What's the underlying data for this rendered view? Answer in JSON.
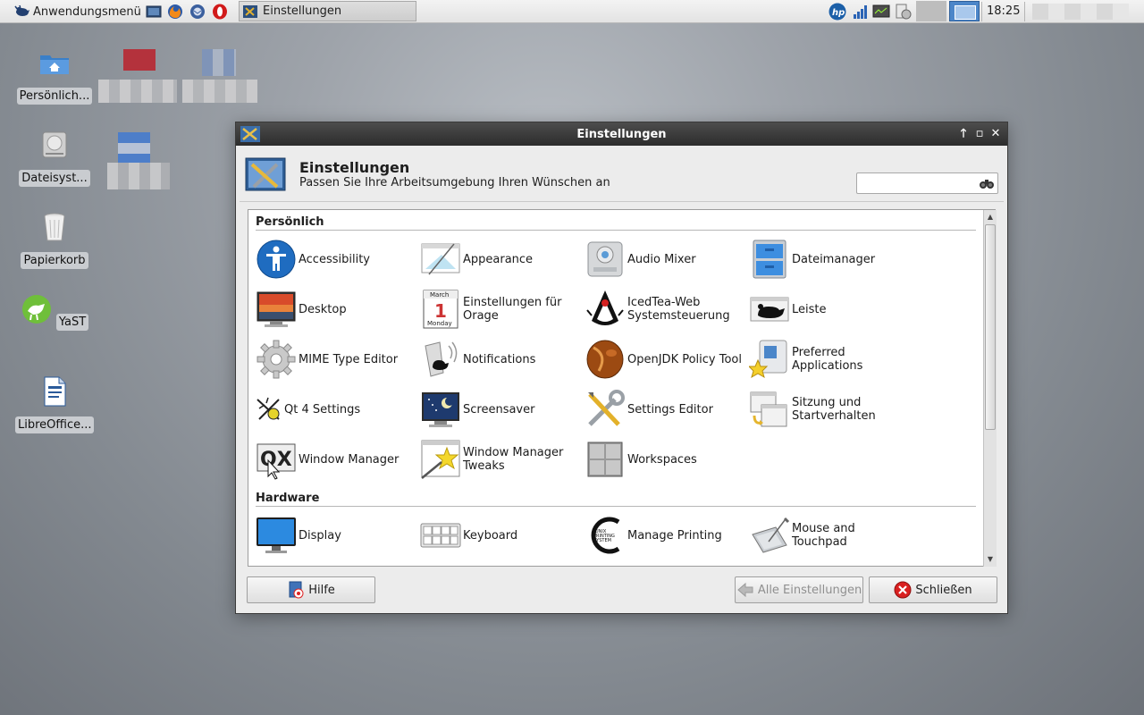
{
  "panel": {
    "menu_label": "Anwendungsmenü",
    "task_label": "Einstellungen",
    "clock": "18:25"
  },
  "desktop": {
    "icons": [
      {
        "label": "Persönlich..."
      },
      {
        "label": "Dateisyst..."
      },
      {
        "label": "Papierkorb"
      },
      {
        "label": "YaST"
      },
      {
        "label": "LibreOffice..."
      }
    ]
  },
  "window": {
    "title": "Einstellungen",
    "header_title": "Einstellungen",
    "header_subtitle": "Passen Sie Ihre Arbeitsumgebung Ihren Wünschen an",
    "search_value": "",
    "sections": [
      {
        "title": "Persönlich",
        "items": [
          {
            "label": "Accessibility",
            "icon": "accessibility-icon"
          },
          {
            "label": "Appearance",
            "icon": "appearance-icon"
          },
          {
            "label": "Audio Mixer",
            "icon": "audio-mixer-icon"
          },
          {
            "label": "Dateimanager",
            "icon": "file-manager-icon"
          },
          {
            "label": "Desktop",
            "icon": "desktop-icon"
          },
          {
            "label": "Einstellungen für Orage",
            "icon": "calendar-icon"
          },
          {
            "label": "IcedTea-Web Systemsteuerung",
            "icon": "java-duke-icon"
          },
          {
            "label": "Leiste",
            "icon": "panel-icon"
          },
          {
            "label": "MIME Type Editor",
            "icon": "gear-icon"
          },
          {
            "label": "Notifications",
            "icon": "notifications-icon"
          },
          {
            "label": "OpenJDK Policy Tool",
            "icon": "coffee-bean-icon"
          },
          {
            "label": "Preferred Applications",
            "icon": "preferred-apps-icon"
          },
          {
            "label": "Qt 4 Settings",
            "icon": "qt-settings-icon"
          },
          {
            "label": "Screensaver",
            "icon": "screensaver-icon"
          },
          {
            "label": "Settings Editor",
            "icon": "settings-editor-icon"
          },
          {
            "label": "Sitzung und Startverhalten",
            "icon": "session-icon"
          },
          {
            "label": "Window Manager",
            "icon": "window-manager-icon"
          },
          {
            "label": "Window Manager Tweaks",
            "icon": "wm-tweaks-icon"
          },
          {
            "label": "Workspaces",
            "icon": "workspaces-icon"
          }
        ]
      },
      {
        "title": "Hardware",
        "items": [
          {
            "label": "Display",
            "icon": "display-icon"
          },
          {
            "label": "Keyboard",
            "icon": "keyboard-icon"
          },
          {
            "label": "Manage Printing",
            "icon": "printing-icon"
          },
          {
            "label": "Mouse and Touchpad",
            "icon": "mouse-touchpad-icon"
          }
        ]
      }
    ],
    "buttons": {
      "help": "Hilfe",
      "all_settings": "Alle Einstellungen",
      "close": "Schließen"
    }
  },
  "colors": {
    "titlebar": "#333333",
    "accent_blue": "#2f7fd0"
  }
}
